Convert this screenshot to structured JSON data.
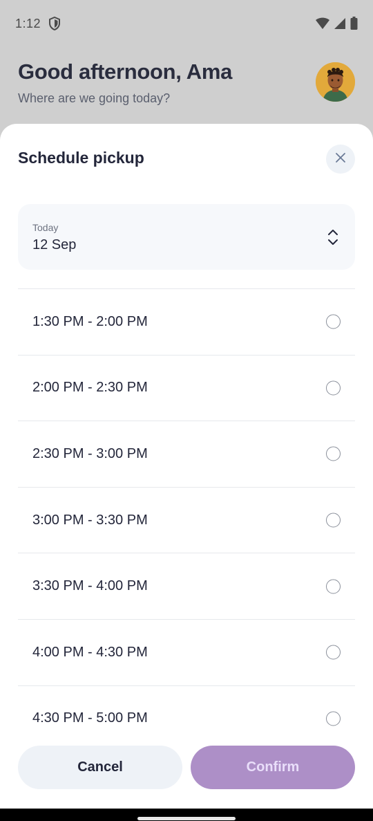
{
  "status_bar": {
    "time": "1:12",
    "icons": [
      "shield-icon",
      "wifi-icon",
      "signal-icon",
      "battery-icon"
    ]
  },
  "header": {
    "greeting": "Good afternoon, Ama",
    "subtitle": "Where are we going today?",
    "avatar_icon": "avatar"
  },
  "sheet": {
    "title": "Schedule pickup",
    "close_icon": "close-icon",
    "date": {
      "label": "Today",
      "value": "12 Sep",
      "icon": "up-down-chevron-icon"
    },
    "slots": [
      {
        "label": "1:30 PM - 2:00 PM",
        "selected": false
      },
      {
        "label": "2:00 PM - 2:30 PM",
        "selected": false
      },
      {
        "label": "2:30 PM - 3:00 PM",
        "selected": false
      },
      {
        "label": "3:00 PM - 3:30 PM",
        "selected": false
      },
      {
        "label": "3:30 PM - 4:00 PM",
        "selected": false
      },
      {
        "label": "4:00 PM - 4:30 PM",
        "selected": false
      },
      {
        "label": "4:30 PM - 5:00 PM",
        "selected": false
      }
    ],
    "cancel_label": "Cancel",
    "confirm_label": "Confirm"
  },
  "colors": {
    "backdrop": "#cfcfcf",
    "confirm_disabled": "#ad8fc7",
    "text_primary": "#23263a"
  }
}
